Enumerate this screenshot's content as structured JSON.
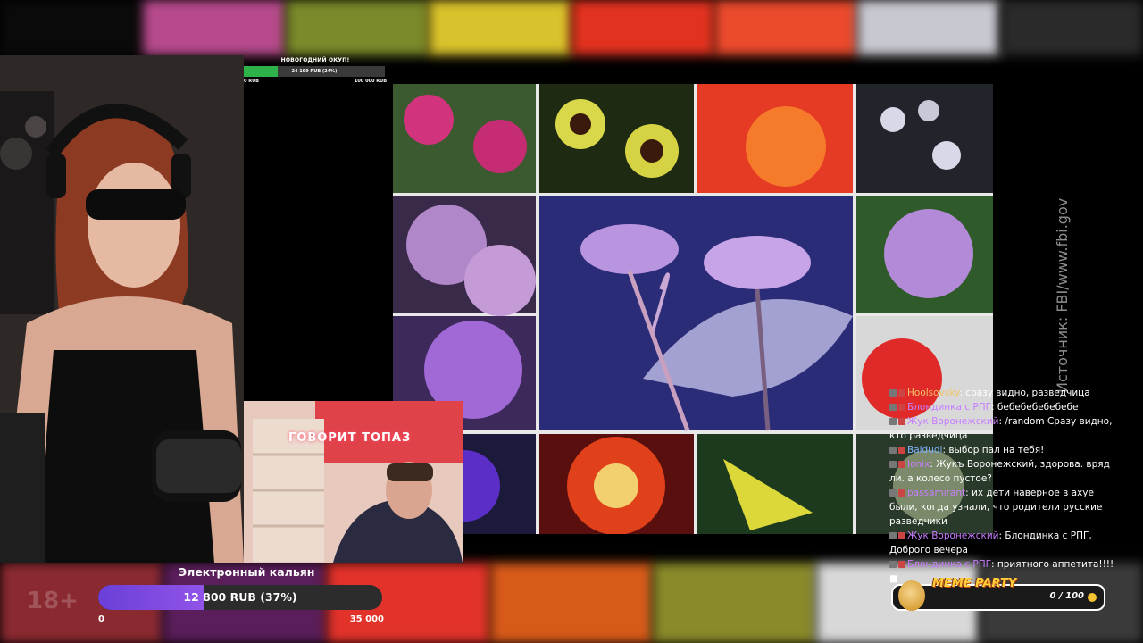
{
  "goal_small": {
    "title": "НОВОГОДНИЙ ОКУП!",
    "progress_text": "24 199 RUB (24%)",
    "progress_fraction": 0.24,
    "min": "0 RUB",
    "max": "100 000 RUB"
  },
  "cam2": {
    "neon_sign": "ГОВОРИТ ТОПАЗ"
  },
  "watermark": "Источник: FBI/www.fbi.gov",
  "chat": [
    {
      "user": "Hoolsovsky",
      "text": "сразу видно, разведчица",
      "color": "#f0c36a"
    },
    {
      "user": "Блондинка с РПГ",
      "text": "бебебебебебебе",
      "color": "#c77dff"
    },
    {
      "user": "Жук Воронежский",
      "text": "/random Сразу видно, кто разведчица",
      "color": "#c77dff"
    },
    {
      "user": "Baldudi",
      "text": "выбор пал на тебя!",
      "color": "#7fb3ff"
    },
    {
      "user": "Ionix",
      "text": "Жукъ Воронежский, здорова. вряд ли. а колесо пустое?",
      "color": "#c77dff"
    },
    {
      "user": "passamirant",
      "text": "их дети наверное в ахуе были, когда узнали, что родители русские разведчики",
      "color": "#c77dff"
    },
    {
      "user": "Жук Воронежский",
      "text": "Блондинка с РПГ, Доброго вечера",
      "color": "#c77dff"
    },
    {
      "user": "Блондинка с РПГ",
      "text": "приятного аппетита!!!! ■",
      "color": "#c77dff"
    }
  ],
  "goal_big": {
    "title": "Электронный кальян",
    "progress_text": "12 800 RUB (37%)",
    "progress_fraction": 0.37,
    "min": "0",
    "max": "35 000"
  },
  "age_badge": "18+",
  "meme_party": {
    "label": "MEME PARTY",
    "count": "0 / 100"
  },
  "colors": {
    "goal_small_fill": "#2db34a",
    "goal_big_fill": "#7a48e0",
    "meme_label": "#ffd23c"
  }
}
